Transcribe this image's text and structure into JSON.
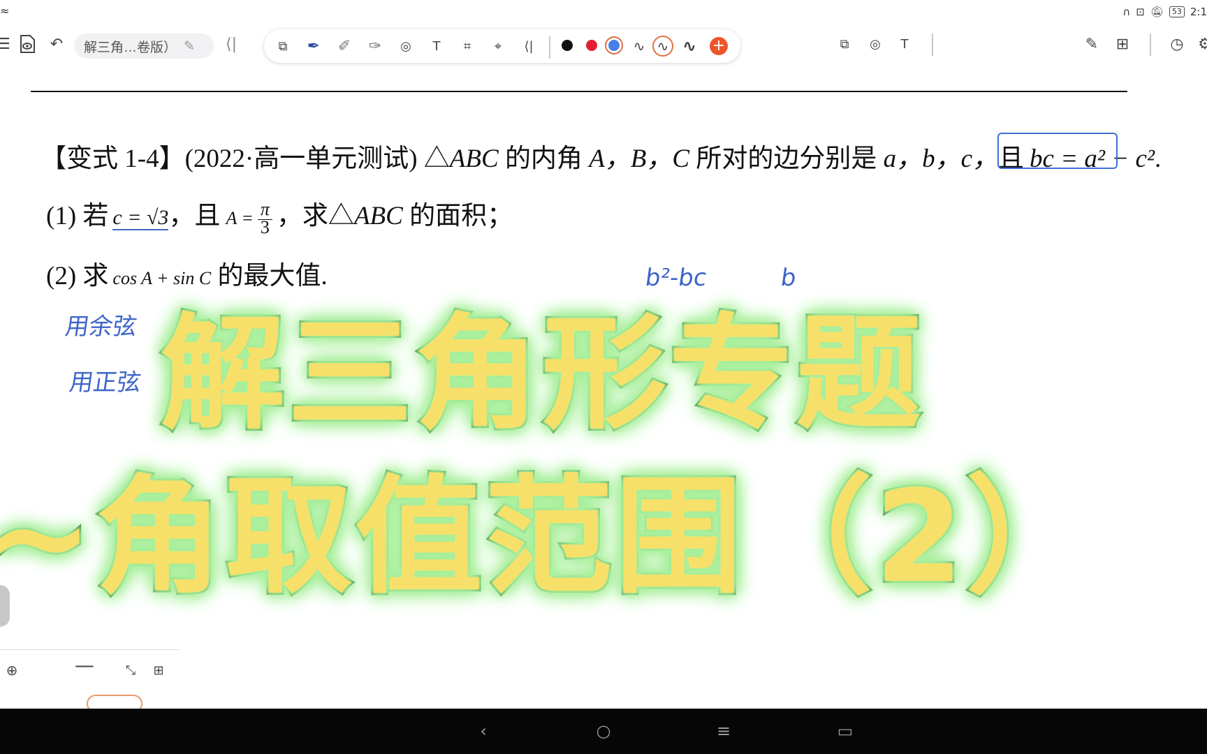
{
  "statusbar": {
    "battery": "53",
    "time": "2:1"
  },
  "toolbar": {
    "document_title": "解三角…卷版）",
    "ink_colors": [
      "#111111",
      "#e02030",
      "#4a7ee8"
    ],
    "add_color": "#f0552a"
  },
  "document": {
    "question_header": "【变式 1-4】(2022·高一单元测试) △",
    "question_rest": " 的内角 ",
    "question_sides": " 所对的边分别是 ",
    "question_and": "且",
    "triangle": "ABC",
    "angles": "A，B，C",
    "sides": "a，b，c，",
    "boxed_equation": "bc = a² − c²",
    "period": ".",
    "part1_prefix": "(1)  若",
    "part1_c": "c = √3",
    "part1_and": "，且",
    "part1_A": "A =",
    "part1_num": "π",
    "part1_den": "3",
    "part1_suffix": "，求△",
    "part1_tri": "ABC",
    "part1_end": " 的面积；",
    "part2_prefix": "(2)  求",
    "part2_expr": "cos A + sin C",
    "part2_end": " 的最大值."
  },
  "handwriting": {
    "note1": "用余弦",
    "note2": "用正弦",
    "expr1": "b²-bc",
    "expr2": "b"
  },
  "title_overlay": {
    "line1": "解三角形专题",
    "line2": "~角取值范围（2）"
  },
  "navbar": {
    "back": "‹",
    "home": "○",
    "menu": "≡",
    "recent": "▭"
  }
}
